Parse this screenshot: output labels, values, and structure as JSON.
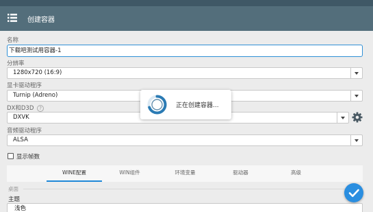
{
  "appbar": {
    "title": "创建容器"
  },
  "form": {
    "name_label": "名称",
    "name_value": "下载吧测试用容器-1",
    "resolution_label": "分辨率",
    "resolution_value": "1280x720 (16:9)",
    "gpu_driver_label": "显卡驱动程序",
    "gpu_driver_value": "Turnip (Adreno)",
    "dx_label": "DX和D3D",
    "dx_help": "?",
    "dx_value": "DXVK",
    "audio_driver_label": "音频驱动程序",
    "audio_driver_value": "ALSA",
    "show_fps_label": "显示帧数",
    "show_fps_checked": false
  },
  "tabs": [
    {
      "label": "WINE配置",
      "active": true
    },
    {
      "label": "WIN组件",
      "active": false
    },
    {
      "label": "环境变量",
      "active": false
    },
    {
      "label": "驱动器",
      "active": false
    },
    {
      "label": "高级",
      "active": false
    }
  ],
  "wine_config": {
    "section_legend": "桌面",
    "theme_label": "主题",
    "theme_value": "浅色"
  },
  "dialog": {
    "message": "正在创建容器..."
  },
  "colors": {
    "appbar": "#536e7b",
    "statusbar": "#3f5866",
    "accent": "#2a8ee0"
  }
}
